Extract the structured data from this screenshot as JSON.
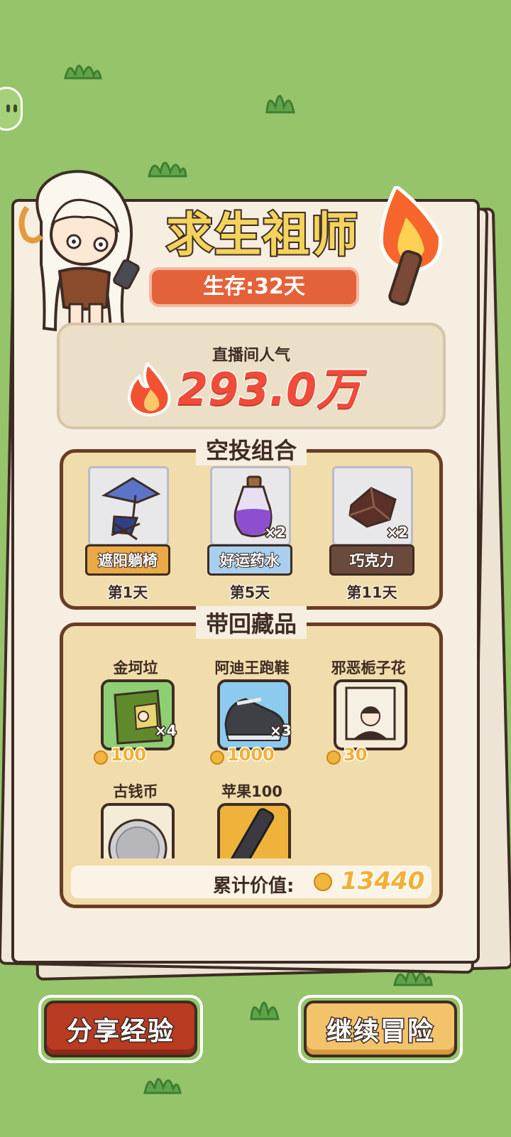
{
  "header": {
    "title": "求生祖师",
    "survival_days": "生存:32天"
  },
  "popularity": {
    "label": "直播间人气",
    "value": "293.0万"
  },
  "airdrop": {
    "title": "空投组合",
    "items": [
      {
        "name": "遮阳躺椅",
        "day": "第1天",
        "quantity": "",
        "name_bg": "#eaa947"
      },
      {
        "name": "好运药水",
        "day": "第5天",
        "quantity": "×2",
        "name_bg": "#a8d0ee"
      },
      {
        "name": "巧克力",
        "day": "第11天",
        "quantity": "×2",
        "name_bg": "#6b4a3e"
      }
    ]
  },
  "collectibles": {
    "title": "带回藏品",
    "items": [
      {
        "name": "金坷垃",
        "price": "100",
        "quantity": "×4",
        "card_bg": "#8fcf74"
      },
      {
        "name": "阿迪王跑鞋",
        "price": "1000",
        "quantity": "×3",
        "card_bg": "#8ccbee"
      },
      {
        "name": "邪恶栀子花",
        "price": "30",
        "quantity": "",
        "card_bg": "#f4ecd6"
      },
      {
        "name": "古钱币",
        "price": "",
        "quantity": "",
        "card_bg": "#f4ecd6"
      },
      {
        "name": "苹果100",
        "price": "",
        "quantity": "",
        "card_bg": "#efb33b"
      }
    ],
    "total_label": "累计价值:",
    "total_value": "13440"
  },
  "buttons": {
    "share": "分享经验",
    "continue": "继续冒险"
  },
  "icons": [
    "fire-icon",
    "torch-icon",
    "coin-icon",
    "lounge-chair-icon",
    "potion-icon",
    "chocolate-icon",
    "fertilizer-bag-icon",
    "sneaker-icon",
    "book-icon",
    "old-coin-icon",
    "phone-icon"
  ],
  "colors": {
    "grass": "#95c46a",
    "paper": "#f6eee0",
    "outline": "#3e2c24",
    "title_yellow": "#f3d35c",
    "banner_red": "#e4623a",
    "popularity_red": "#ef4c3a",
    "coin_gold": "#f2b035"
  }
}
